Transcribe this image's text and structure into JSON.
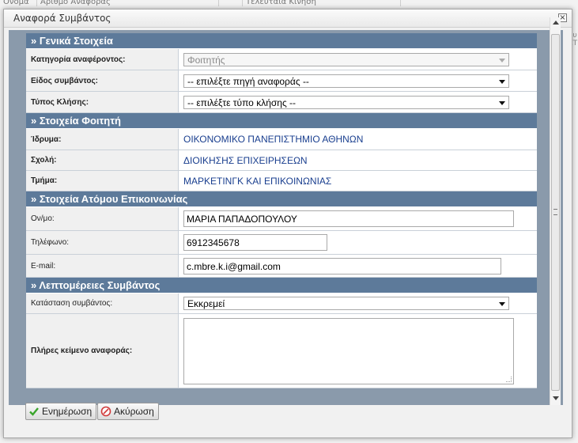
{
  "dialog": {
    "title": "Αναφορά Συμβάντος",
    "close_label": "×"
  },
  "sections": {
    "general": "» Γενικά Στοιχεία",
    "student": "» Στοιχεία Φοιτητή",
    "contact": "» Στοιχεία Ατόμου Επικοινωνίας",
    "details": "» Λεπτομέρειες Συμβάντος"
  },
  "general": {
    "category_label": "Κατηγορία αναφέροντος:",
    "category_value": "Φοιτητής",
    "type_label": "Είδος συμβάντος:",
    "type_value": "-- επιλέξτε πηγή αναφοράς --",
    "call_label": "Τύπος Κλήσης:",
    "call_value": "-- επιλέξτε τύπο κλήσης --"
  },
  "student": {
    "institution_label": "Ίδρυμα:",
    "institution_value": "ΟΙΚΟΝΟΜΙΚΟ ΠΑΝΕΠΙΣΤΗΜΙΟ ΑΘΗΝΩΝ",
    "school_label": "Σχολή:",
    "school_value": "ΔΙΟΙΚΗΣΗΣ ΕΠΙΧΕΙΡΗΣΕΩΝ",
    "department_label": "Τμήμα:",
    "department_value": "ΜΑΡΚΕΤΙΝΓΚ ΚΑΙ ΕΠΙΚΟΙΝΩΝΙΑΣ"
  },
  "contact": {
    "name_label": "Ον/μο:",
    "name_value": "ΜΑΡΙΑ ΠΑΠΑΔΟΠΟΥΛΟΥ",
    "phone_label": "Τηλέφωνο:",
    "phone_value": "6912345678",
    "email_label": "E-mail:",
    "email_value": "c.mbre.k.i@gmail.com"
  },
  "details": {
    "status_label": "Κατάσταση συμβάντος:",
    "status_value": "Εκκρεμεί",
    "text_label": "Πλήρες κείμενο αναφοράς:",
    "text_value": ""
  },
  "buttons": {
    "update": "Ενημέρωση",
    "cancel": "Ακύρωση"
  },
  "background": {
    "columns": [
      "Ονομα",
      "Αριθμό Αναφοράς",
      "",
      "Τελευταία Κίνηση"
    ],
    "side_text": "ου\nΣΤ"
  },
  "colors": {
    "section_header": "#5d7a9a",
    "link_text": "#1a3f8f",
    "content_bg": "#8a9aab"
  }
}
